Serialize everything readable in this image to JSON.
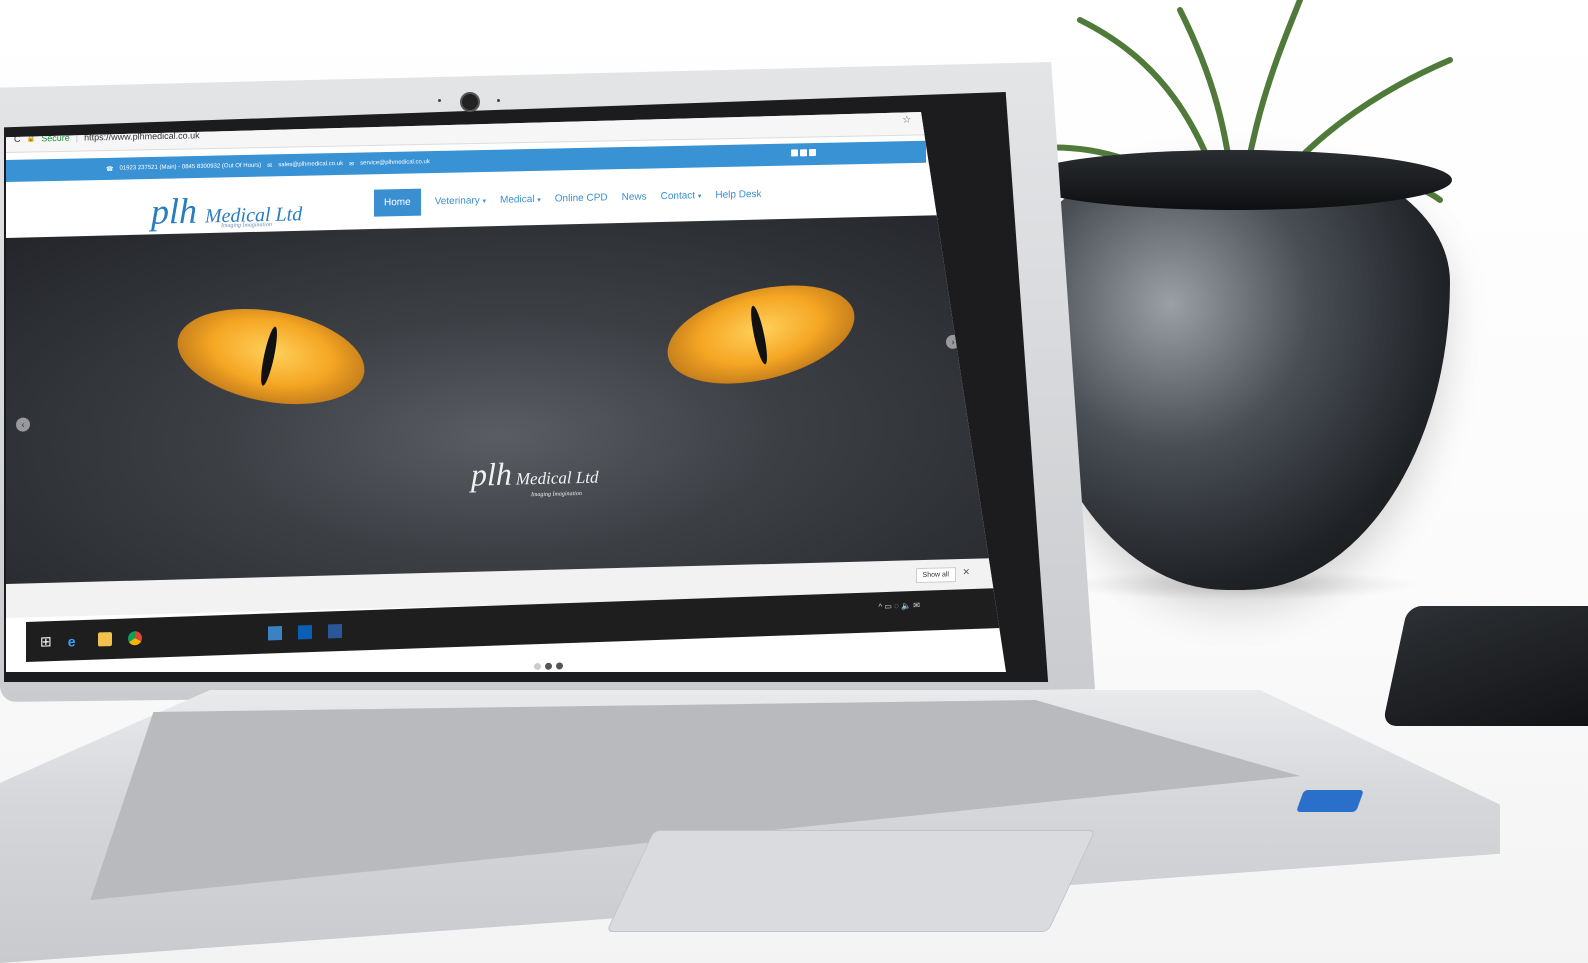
{
  "browser": {
    "secure_label": "Secure",
    "url": "https://www.plhmedical.co.uk"
  },
  "topbar": {
    "phone": "01923 237521 (Main) - 0845 8300932 (Out Of Hours)",
    "email_sales": "sales@plhmedical.co.uk",
    "email_service": "service@plhmedical.co.uk"
  },
  "logo": {
    "mark": "plh",
    "name": "Medical Ltd",
    "tagline": "Imaging Imagination"
  },
  "nav": {
    "items": [
      {
        "label": "Home"
      },
      {
        "label": "Veterinary"
      },
      {
        "label": "Medical"
      },
      {
        "label": "Online CPD"
      },
      {
        "label": "News"
      },
      {
        "label": "Contact"
      },
      {
        "label": "Help Desk"
      }
    ],
    "caret": "▾"
  },
  "hero": {
    "logo_mark": "plh",
    "logo_name": "Medical Ltd",
    "logo_tagline": "Imaging Imagination",
    "prev": "‹",
    "next": "›"
  },
  "downloads": {
    "show_all": "Show all",
    "close": "✕"
  },
  "icons": {
    "reload": "C",
    "lock": "🔒",
    "star": "☆",
    "menu": "⋮",
    "phone": "☎",
    "mail": "✉",
    "windows": "⊞"
  },
  "colors": {
    "brand": "#3892d4",
    "secure": "#1e8e3e",
    "taskbar": "#1e1e1e"
  }
}
